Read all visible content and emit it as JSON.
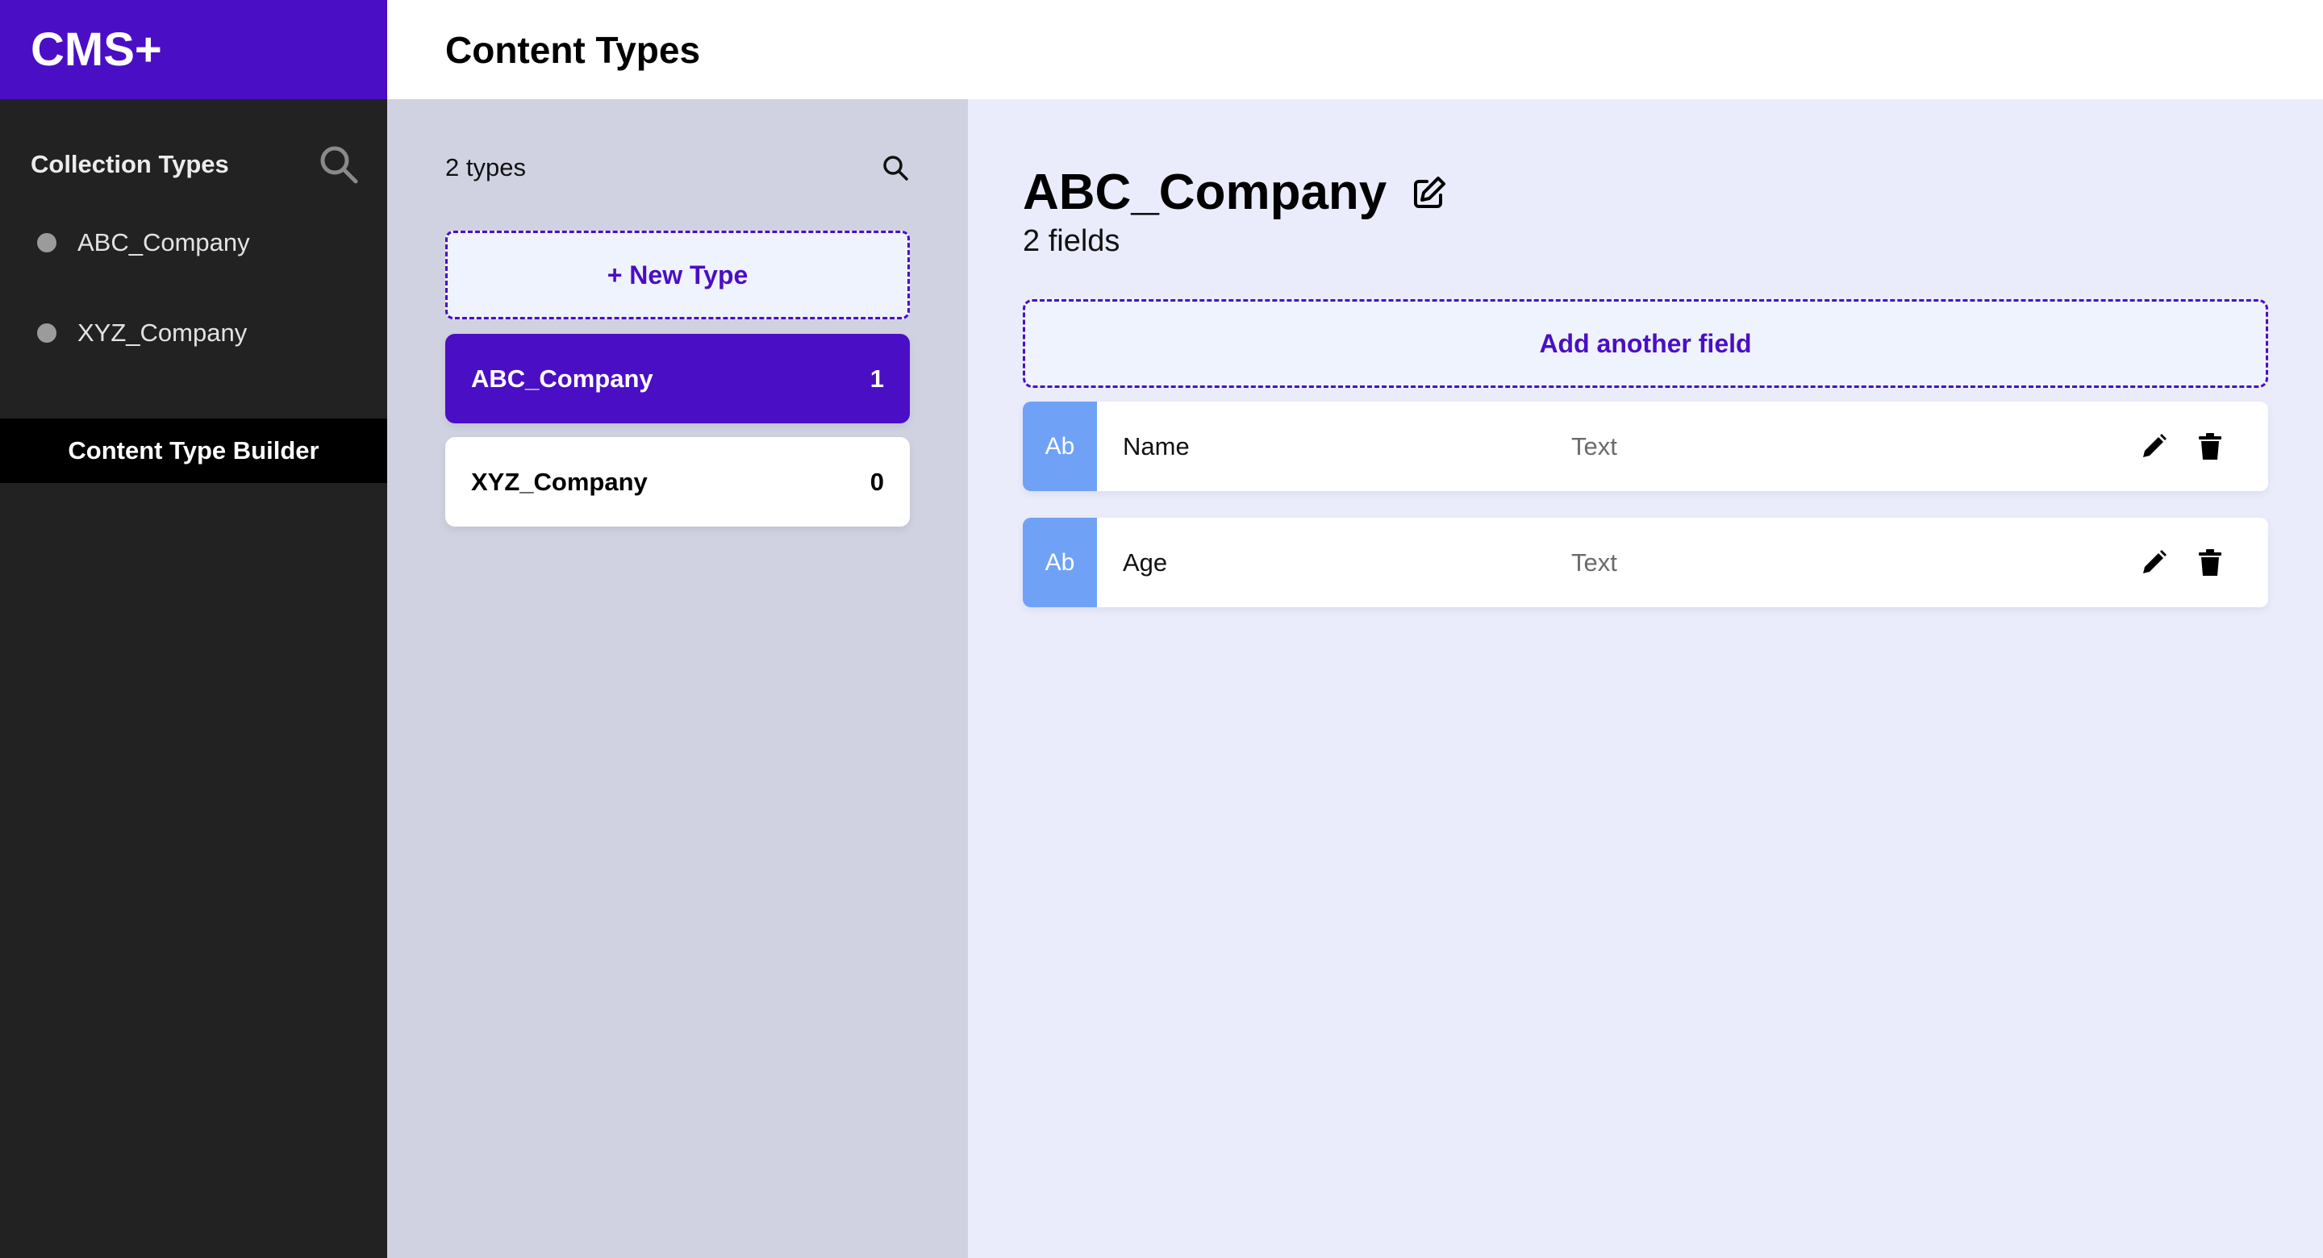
{
  "app": {
    "brand": "CMS+"
  },
  "sidebar": {
    "section_title": "Collection Types",
    "items": [
      {
        "label": "ABC_Company"
      },
      {
        "label": "XYZ_Company"
      }
    ],
    "builder_label": "Content Type Builder"
  },
  "header": {
    "title": "Content Types"
  },
  "types_panel": {
    "count_label": "2 types",
    "new_type_label": "+ New Type",
    "types": [
      {
        "name": "ABC_Company",
        "count": "1",
        "active": true
      },
      {
        "name": "XYZ_Company",
        "count": "0",
        "active": false
      }
    ]
  },
  "detail": {
    "type_name": "ABC_Company",
    "fields_count_label": "2 fields",
    "add_field_label": "Add another field",
    "fields": [
      {
        "badge": "Ab",
        "name": "Name",
        "type": "Text"
      },
      {
        "badge": "Ab",
        "name": "Age",
        "type": "Text"
      }
    ]
  },
  "colors": {
    "accent": "#4a0ec5",
    "sidebar_bg": "#222222",
    "middle_bg": "#d0d2e1",
    "main_bg": "#eaecfb",
    "badge_bg": "#6fa2f6"
  }
}
